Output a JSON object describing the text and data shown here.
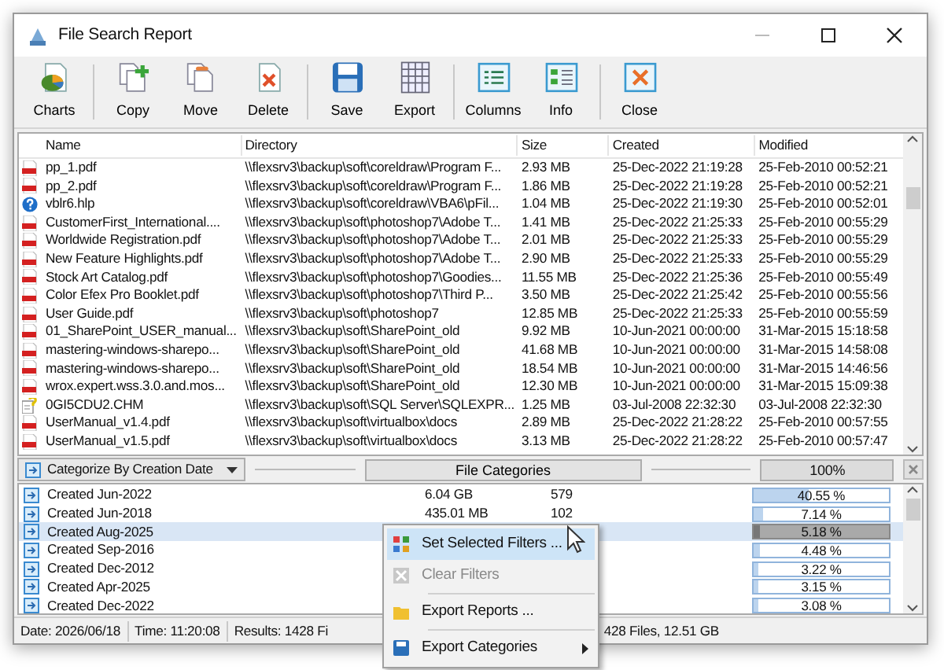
{
  "window": {
    "title": "File Search Report"
  },
  "toolbar": [
    {
      "label": "Charts",
      "separator_before": false
    },
    {
      "label": "Copy",
      "separator_before": true
    },
    {
      "label": "Move",
      "separator_before": false
    },
    {
      "label": "Delete",
      "separator_before": false
    },
    {
      "label": "Save",
      "separator_before": true
    },
    {
      "label": "Export",
      "separator_before": false
    },
    {
      "label": "Columns",
      "separator_before": true
    },
    {
      "label": "Info",
      "separator_before": false
    },
    {
      "label": "Close",
      "separator_before": true
    }
  ],
  "table": {
    "columns": [
      "Name",
      "Directory",
      "Size",
      "Created",
      "Modified"
    ],
    "rows": [
      {
        "kind": "pdf",
        "name": "pp_1.pdf",
        "directory": "\\\\flexsrv3\\backup\\soft\\coreldraw\\Program F...",
        "size": "2.93 MB",
        "created": "25-Dec-2022 21:19:28",
        "modified": "25-Feb-2010 00:52:21"
      },
      {
        "kind": "pdf",
        "name": "pp_2.pdf",
        "directory": "\\\\flexsrv3\\backup\\soft\\coreldraw\\Program F...",
        "size": "1.86 MB",
        "created": "25-Dec-2022 21:19:28",
        "modified": "25-Feb-2010 00:52:21"
      },
      {
        "kind": "help",
        "name": "vblr6.hlp",
        "directory": "\\\\flexsrv3\\backup\\soft\\coreldraw\\VBA6\\pFil...",
        "size": "1.04 MB",
        "created": "25-Dec-2022 21:19:30",
        "modified": "25-Feb-2010 00:52:01"
      },
      {
        "kind": "pdf",
        "name": "CustomerFirst_International....",
        "directory": "\\\\flexsrv3\\backup\\soft\\photoshop7\\Adobe T...",
        "size": "1.41 MB",
        "created": "25-Dec-2022 21:25:33",
        "modified": "25-Feb-2010 00:55:29"
      },
      {
        "kind": "pdf",
        "name": "Worldwide Registration.pdf",
        "directory": "\\\\flexsrv3\\backup\\soft\\photoshop7\\Adobe T...",
        "size": "2.01 MB",
        "created": "25-Dec-2022 21:25:33",
        "modified": "25-Feb-2010 00:55:29"
      },
      {
        "kind": "pdf",
        "name": "New Feature Highlights.pdf",
        "directory": "\\\\flexsrv3\\backup\\soft\\photoshop7\\Adobe T...",
        "size": "2.90 MB",
        "created": "25-Dec-2022 21:25:33",
        "modified": "25-Feb-2010 00:55:29"
      },
      {
        "kind": "pdf",
        "name": "Stock Art Catalog.pdf",
        "directory": "\\\\flexsrv3\\backup\\soft\\photoshop7\\Goodies...",
        "size": "11.55 MB",
        "created": "25-Dec-2022 21:25:36",
        "modified": "25-Feb-2010 00:55:49"
      },
      {
        "kind": "pdf",
        "name": "Color Efex Pro Booklet.pdf",
        "directory": "\\\\flexsrv3\\backup\\soft\\photoshop7\\Third P...",
        "size": "3.50 MB",
        "created": "25-Dec-2022 21:25:42",
        "modified": "25-Feb-2010 00:55:56"
      },
      {
        "kind": "pdf",
        "name": "User Guide.pdf",
        "directory": "\\\\flexsrv3\\backup\\soft\\photoshop7",
        "size": "12.85 MB",
        "created": "25-Dec-2022 21:25:33",
        "modified": "25-Feb-2010 00:55:59"
      },
      {
        "kind": "pdf",
        "name": "01_SharePoint_USER_manual...",
        "directory": "\\\\flexsrv3\\backup\\soft\\SharePoint_old",
        "size": "9.92 MB",
        "created": "10-Jun-2021 00:00:00",
        "modified": "31-Mar-2015 15:18:58"
      },
      {
        "kind": "pdf",
        "name": "mastering-windows-sharepo...",
        "directory": "\\\\flexsrv3\\backup\\soft\\SharePoint_old",
        "size": "41.68 MB",
        "created": "10-Jun-2021 00:00:00",
        "modified": "31-Mar-2015 14:58:08"
      },
      {
        "kind": "pdf",
        "name": "mastering-windows-sharepo...",
        "directory": "\\\\flexsrv3\\backup\\soft\\SharePoint_old",
        "size": "18.54 MB",
        "created": "10-Jun-2021 00:00:00",
        "modified": "31-Mar-2015 14:46:56"
      },
      {
        "kind": "pdf",
        "name": "wrox.expert.wss.3.0.and.mos...",
        "directory": "\\\\flexsrv3\\backup\\soft\\SharePoint_old",
        "size": "12.30 MB",
        "created": "10-Jun-2021 00:00:00",
        "modified": "31-Mar-2015 15:09:38"
      },
      {
        "kind": "chm",
        "name": "0GI5CDU2.CHM",
        "directory": "\\\\flexsrv3\\backup\\soft\\SQL Server\\SQLEXPR...",
        "size": "1.25 MB",
        "created": "03-Jul-2008 22:32:30",
        "modified": "03-Jul-2008 22:32:30"
      },
      {
        "kind": "pdf",
        "name": "UserManual_v1.4.pdf",
        "directory": "\\\\flexsrv3\\backup\\soft\\virtualbox\\docs",
        "size": "2.89 MB",
        "created": "25-Dec-2022 21:28:22",
        "modified": "25-Feb-2010 00:57:55"
      },
      {
        "kind": "pdf",
        "name": "UserManual_v1.5.pdf",
        "directory": "\\\\flexsrv3\\backup\\soft\\virtualbox\\docs",
        "size": "3.13 MB",
        "created": "25-Dec-2022 21:28:22",
        "modified": "25-Feb-2010 00:57:47"
      }
    ]
  },
  "category_bar": {
    "dropdown": "Categorize By Creation Date",
    "button": "File Categories",
    "progress": {
      "text": "100%",
      "level": 1
    }
  },
  "categories": [
    {
      "label": "Created Jun-2022",
      "size": "6.04 GB",
      "count": "579",
      "percent": "40.55 %",
      "level": 0.4055,
      "selected": false
    },
    {
      "label": "Created Jun-2018",
      "size": "435.01 MB",
      "count": "102",
      "percent": "7.14 %",
      "level": 0.0714,
      "selected": false
    },
    {
      "label": "Created Aug-2025",
      "percent": "5.18 %",
      "level": 0.0518,
      "selected": true
    },
    {
      "label": "Created Sep-2016",
      "percent": "4.48 %",
      "level": 0.0448,
      "selected": false
    },
    {
      "label": "Created Dec-2012",
      "percent": "3.22 %",
      "level": 0.0322,
      "selected": false
    },
    {
      "label": "Created Apr-2025",
      "percent": "3.15 %",
      "level": 0.0315,
      "selected": false
    },
    {
      "label": "Created Dec-2022",
      "percent": "3.08 %",
      "level": 0.0308,
      "selected": false
    }
  ],
  "context_menu": [
    {
      "label": "Set Selected Filters ...",
      "selected": true,
      "disabled": false,
      "submenu": false
    },
    {
      "label": "Clear Filters",
      "selected": false,
      "disabled": true,
      "submenu": false
    },
    {
      "label": "Export Reports ...",
      "selected": false,
      "disabled": false,
      "submenu": false
    },
    {
      "label": "Export Categories",
      "selected": false,
      "disabled": false,
      "submenu": true
    }
  ],
  "status_bar": [
    "Date: 2026/06/18",
    "Time: 11:20:08",
    "Results: 1428 Fi",
    "428 Files, 12.51 GB"
  ]
}
